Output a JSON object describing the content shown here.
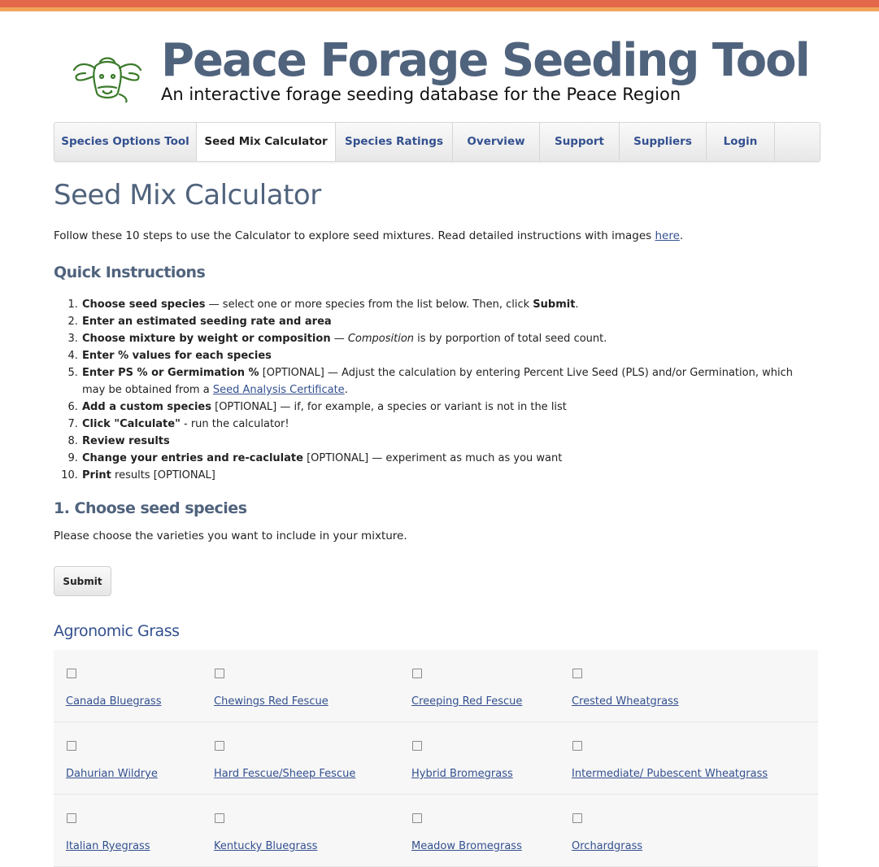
{
  "site": {
    "title": "Peace Forage Seeding Tool",
    "subtitle": "An interactive forage seeding database for the Peace Region"
  },
  "nav": [
    {
      "label": "Species Options Tool",
      "active": false
    },
    {
      "label": "Seed Mix Calculator",
      "active": true
    },
    {
      "label": "Species Ratings",
      "active": false
    },
    {
      "label": "Overview",
      "active": false
    },
    {
      "label": "Support",
      "active": false
    },
    {
      "label": "Suppliers",
      "active": false
    },
    {
      "label": "Login",
      "active": false
    }
  ],
  "page": {
    "title": "Seed Mix Calculator",
    "intro_text": "Follow these 10 steps to use the Calculator to explore seed mixtures. Read detailed instructions with images ",
    "intro_link": "here",
    "intro_end": "."
  },
  "quick": {
    "heading": "Quick Instructions",
    "steps": [
      {
        "bold": "Choose seed species",
        "text": " — select one or more species from the list below. Then, click ",
        "bold2": "Submit",
        "text2": "."
      },
      {
        "bold": "Enter an estimated seeding rate and area",
        "text": ""
      },
      {
        "bold": "Choose mixture by weight or composition",
        "text": " — ",
        "italic": "Composition",
        "text2": " is by porportion of total seed count."
      },
      {
        "bold": "Enter % values for each species",
        "text": ""
      },
      {
        "bold": "Enter PS % or Germimation %",
        "text": " [OPTIONAL] —  Adjust the calculation by entering Percent Live Seed (PLS)  and/or Germination, which may be obtained from a ",
        "link": "Seed Analysis Certificate",
        "text2": "."
      },
      {
        "bold": "Add a custom species",
        "text": " [OPTIONAL] — if, for example, a species or variant is not in the list"
      },
      {
        "bold": "Click \"Calculate\"",
        "text": " - run the calculator!"
      },
      {
        "bold": "Review results",
        "text": ""
      },
      {
        "bold": "Change your entries and re-caclulate",
        "text": " [OPTIONAL] — experiment as much as you want"
      },
      {
        "bold": "Print",
        "text": " results [OPTIONAL]"
      }
    ]
  },
  "choose": {
    "heading": "1. Choose seed species",
    "text": "Please choose the varieties you want to include in your mixture.",
    "submit_label": "Submit"
  },
  "category": {
    "title": "Agronomic Grass",
    "rows": [
      [
        "Canada Bluegrass",
        "Chewings Red Fescue",
        "Creeping Red Fescue",
        "Crested Wheatgrass"
      ],
      [
        "Dahurian Wildrye",
        "Hard Fescue/Sheep Fescue",
        "Hybrid Bromegrass",
        "Intermediate/ Pubescent Wheatgrass"
      ],
      [
        "Italian Ryegrass",
        "Kentucky Bluegrass",
        "Meadow Bromegrass",
        "Orchardgrass"
      ]
    ]
  },
  "colors": {
    "accent_top": "#e4674a",
    "title": "#50637d",
    "link": "#33508f"
  },
  "icons": {
    "logo": "cow-head-icon"
  }
}
